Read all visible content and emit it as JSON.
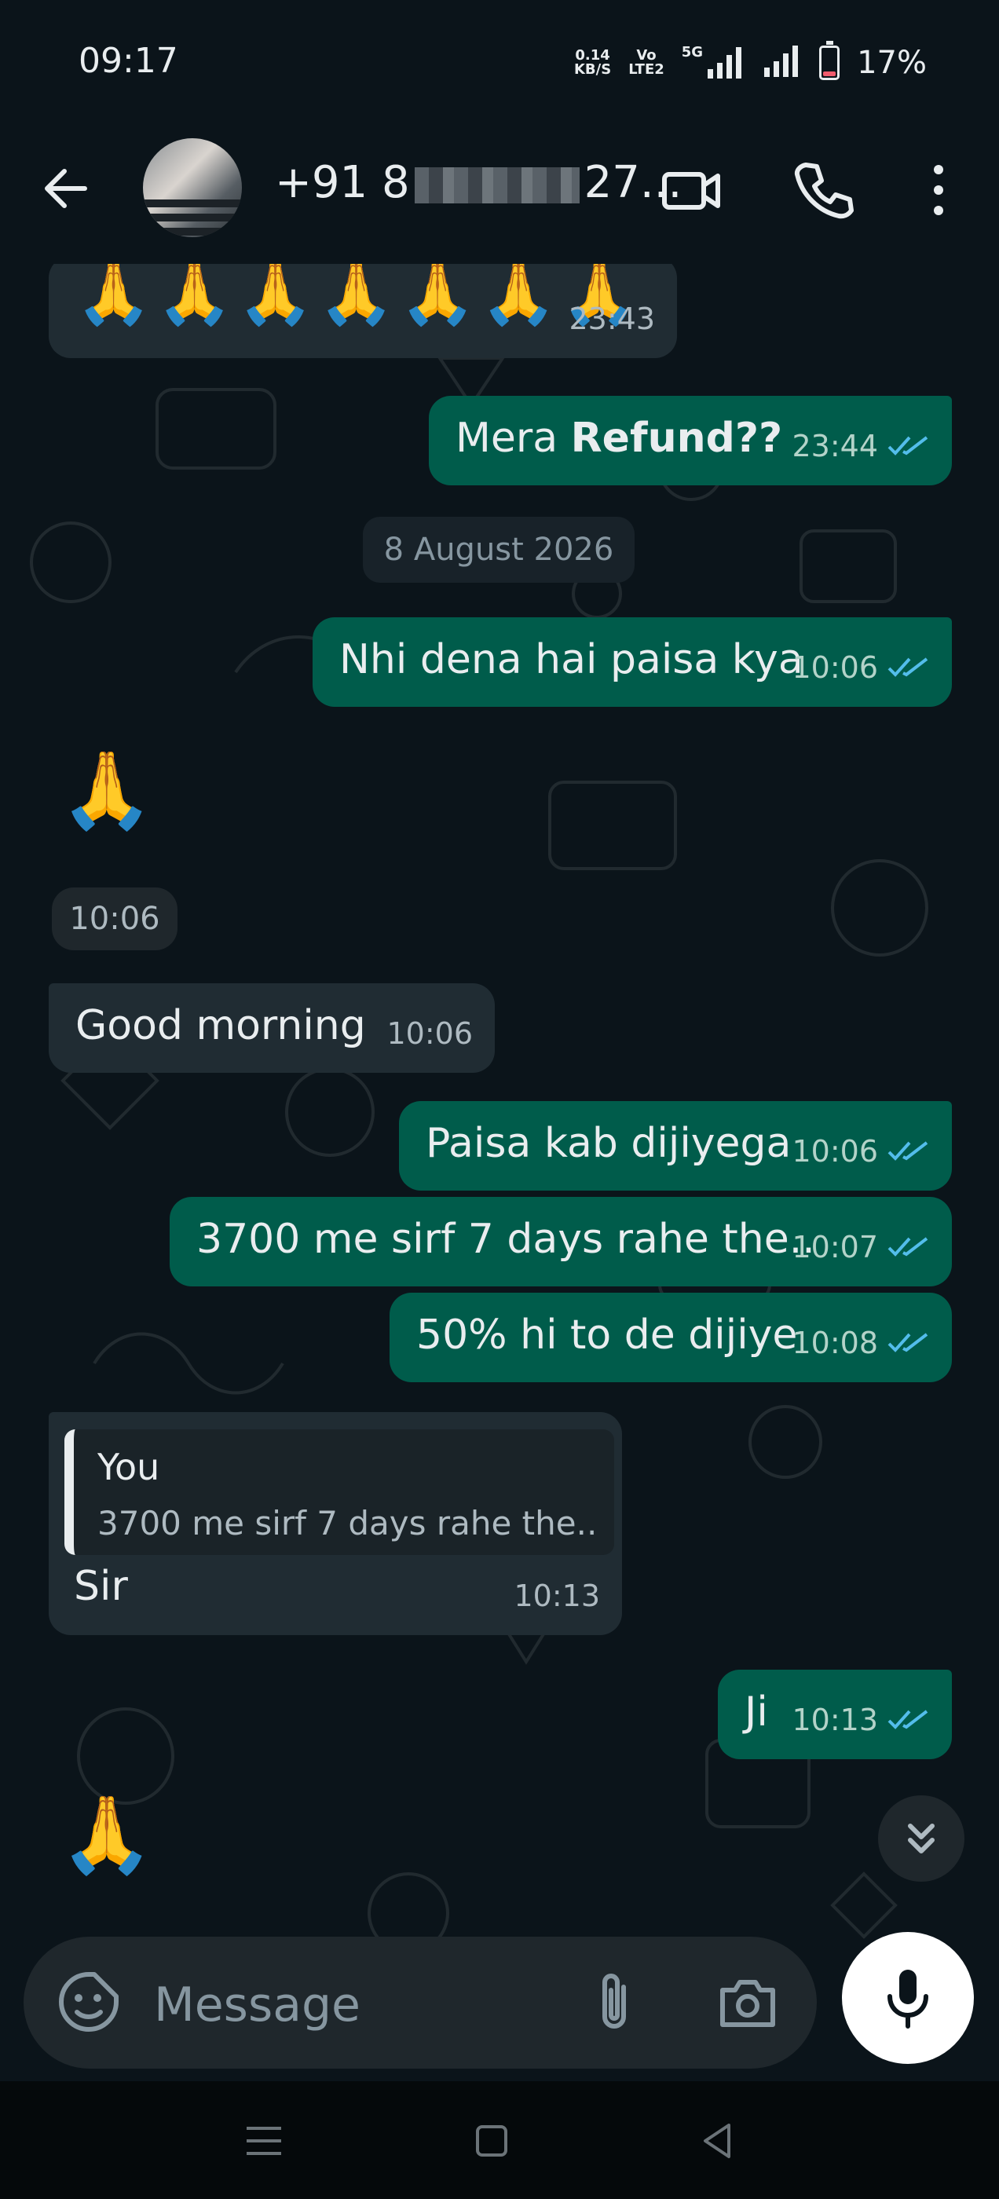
{
  "status_bar": {
    "time": "09:17",
    "net_speed_top": "0.14",
    "net_speed_unit": "KB/S",
    "volte_top": "Vo",
    "volte_bottom": "LTE2",
    "network_5g": "5G",
    "battery_percent": "17%",
    "battery_level": 0.17
  },
  "header": {
    "contact_prefix": "+91 8",
    "contact_suffix": "27...",
    "icons": [
      "back-arrow-icon",
      "video-call-icon",
      "voice-call-icon",
      "more-options-icon"
    ]
  },
  "messages": {
    "m1": {
      "emojis": "🙏🙏🙏🙏🙏🙏🙏",
      "time": "23:43"
    },
    "m2": {
      "text_plain": "Mera ",
      "text_bold": "Refund??",
      "time": "23:44"
    },
    "date_chip": "8 August 2026",
    "m3": {
      "text": "Nhi dena hai paisa kya",
      "time": "10:06"
    },
    "m4": {
      "emoji": "🙏",
      "time": "10:06"
    },
    "m5": {
      "text": "Good morning",
      "time": "10:06"
    },
    "m6": {
      "text": "Paisa kab dijiyega",
      "time": "10:06"
    },
    "m7": {
      "text": "3700 me sirf 7 days rahe the..",
      "time": "10:07"
    },
    "m8": {
      "text": "50% hi to de dijiye",
      "time": "10:08"
    },
    "m9": {
      "quote_author": "You",
      "quote_text": "3700 me sirf 7 days rahe the..",
      "text": "Sir",
      "time": "10:13"
    },
    "m10": {
      "text": "Ji",
      "time": "10:13"
    },
    "m11": {
      "emoji": "🙏"
    }
  },
  "input": {
    "placeholder": "Message"
  },
  "colors": {
    "outgoing_bubble": "#005c4b",
    "incoming_bubble": "#202c33",
    "read_ticks": "#53bdeb",
    "background": "#0b141a"
  }
}
